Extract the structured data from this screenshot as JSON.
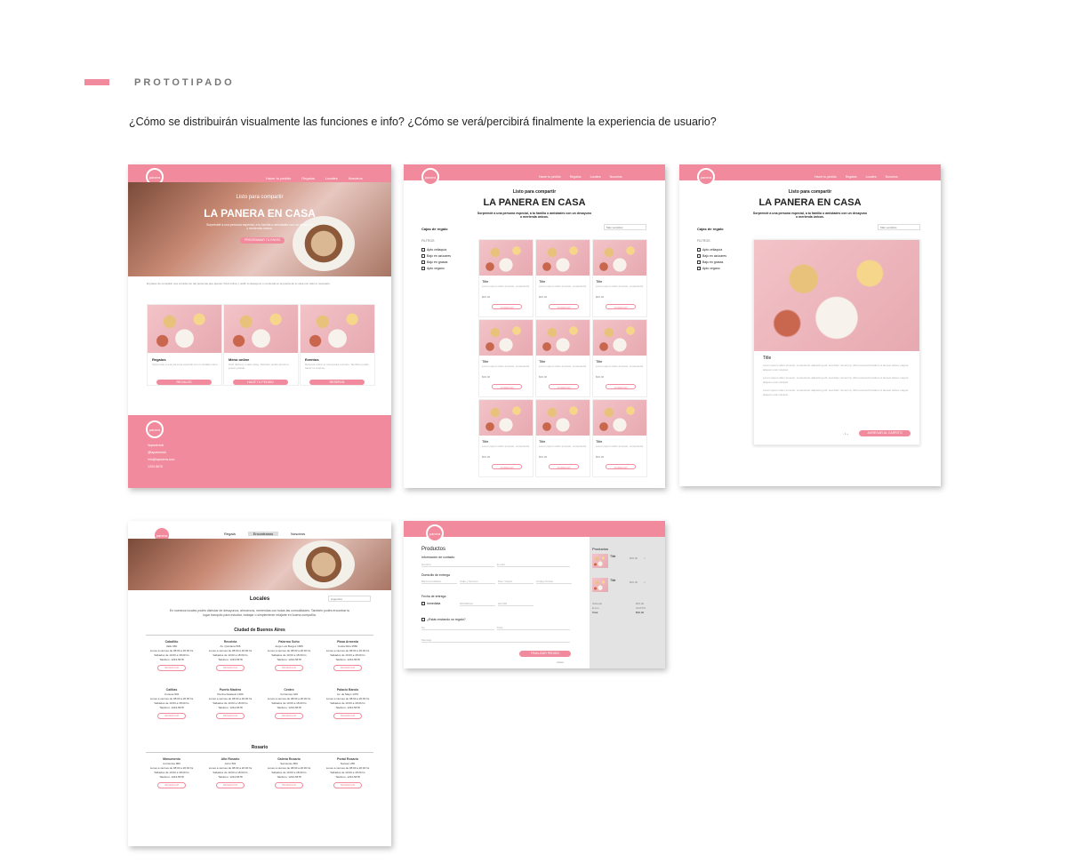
{
  "section": {
    "title": "PROTOTIPADO",
    "question": "¿Cómo se distribuirán visualmente las funciones e info?  ¿Cómo se verá/percibirá finalmente la experiencia de usuario?"
  },
  "brand": {
    "logo": "panera"
  },
  "nav": {
    "items": [
      "Hacer tu pedido",
      "Regalos",
      "Locales",
      "Nosotros"
    ]
  },
  "home": {
    "kicker": "Listo para compartir",
    "title": "LA PANERA EN CASA",
    "subtitle": "Sorprendé a una persona especial, a tu familia o amistades con un desayuno o merienda únicos.",
    "cta": "PROGRAMAR TU ENVÍO",
    "body": "El placer de compartir una comida con las personas que querés. Pedí online y recibí tu desayuno o merienda en la puerta de tu casa con todo lo necesario.",
    "cards": [
      {
        "title": "Regalos",
        "text": "Sorprendé a una persona especial con un detalle único.",
        "btn": "REGALOS"
      },
      {
        "title": "Menú online",
        "text": "Pedí delivery o take away. También podés armar tu propio pedido.",
        "btn": "HACÉ TU PEDIDO"
      },
      {
        "title": "Eventos",
        "text": "Reservá online tu mesa para eventos. También podés hacer tu reserva.",
        "btn": "RESERVÁ"
      }
    ],
    "footer": [
      "/lapaneraok",
      "@lapaneraok",
      "info@lapanera.com",
      "1234-5678"
    ]
  },
  "shop": {
    "kicker": "Listo para compartir",
    "title": "LA PANERA EN CASA",
    "subtitle": "Sorprendé a una persona especial, a tu familia o amistades con un desayuno o merienda únicos.",
    "category": "Cajas de regalo",
    "sort": "Más vendidos",
    "filters_title": "FILTROS",
    "filters": [
      "Apto celiaquía",
      "Bajo en azúcares",
      "Bajo en grasas",
      "Apto vegano"
    ],
    "product": {
      "title": "Title",
      "desc": "Lorem ipsum dolor sit amet, consectetur",
      "price": "$00,00",
      "btn": "AGREGAR"
    }
  },
  "detail": {
    "title": "Title",
    "text": "Lorem ipsum dolor sit amet, consectetur adipiscing elit, sed diam nonummy nibh euismod tincidunt ut laoreet dolore magna aliquam erat volutpat.",
    "qty": "- 1 +",
    "btn": "AGREGAR AL CARRITO"
  },
  "locales": {
    "nav": [
      "Regalá",
      "Encontranos",
      "Nosotros"
    ],
    "title": "Locales",
    "country": "Argentina",
    "intro": "En nuestros locales podés disfrutar de desayunos, almuerzos, meriendas con todas las comodidades. También podés encontrar tu lugar tranquilo para estudiar, trabajar o simplemente relajarte en buena compañía.",
    "btn": "RESERVAR",
    "regions": [
      {
        "name": "Ciudad de Buenos Aires",
        "stores": [
          {
            "name": "Caballito",
            "addr": "Valle 960"
          },
          {
            "name": "Recoleta",
            "addr": "Av. Quintana 595"
          },
          {
            "name": "Palermo Soho",
            "addr": "Jorge Luis Borges 1665"
          },
          {
            "name": "Plaza Armenia",
            "addr": "Costa Rica 4560"
          },
          {
            "name": "Cañitas",
            "addr": "Conesa 904"
          },
          {
            "name": "Puerto Madero",
            "addr": "Pierina Dealessi 1360"
          },
          {
            "name": "Centro",
            "addr": "Corrientes 449"
          },
          {
            "name": "Palacio Barolo",
            "addr": "Av. de Mayo 1370"
          }
        ]
      },
      {
        "name": "Rosario",
        "stores": [
          {
            "name": "Monumento",
            "addr": "Corrientes 860"
          },
          {
            "name": "Alto Rosario",
            "addr": "Junín 501"
          },
          {
            "name": "Galería Rosario",
            "addr": "Sarmiento 850"
          },
          {
            "name": "Portal Rosario",
            "addr": "Nansen 255"
          }
        ]
      }
    ],
    "hours": "Lunes a viernes de 08:00 a 20:00 hs",
    "hours2": "Sábados de 10:00 a 18:00 hs",
    "phone": "Teléfono: 1234-5678"
  },
  "checkout": {
    "title": "Productos",
    "contact": "Información de contacto",
    "name": "Nombre",
    "email": "E-mail",
    "address": "Domicilio de entrega",
    "barrio": "Barrio/Localidad",
    "street": "Calle y Número",
    "floor": "Piso / Depto",
    "zip": "Código Postal",
    "date_title": "Fecha de entrega",
    "inmediata": "Inmediata",
    "date": "DD/MM/AA",
    "time": "HH:MM",
    "gift": "¿Estás enviando un regalo?",
    "de": "De",
    "para": "Para",
    "msg": "Mensaje",
    "btn": "FINALIZAR PEDIDO",
    "back": "volver",
    "summary": "Productos",
    "item": "Title",
    "price": "$00,00",
    "subtotal": "Subtotal",
    "envio": "Envío",
    "envio_val": "GRATIS",
    "total": "Total",
    "total_val": "$00,00"
  }
}
